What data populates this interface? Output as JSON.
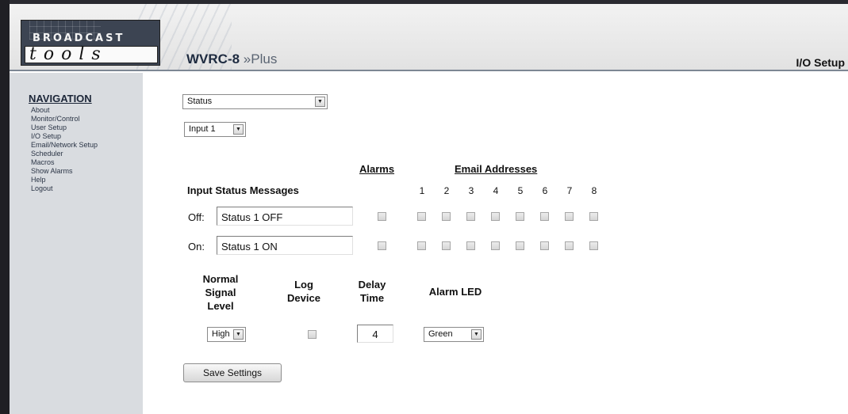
{
  "header": {
    "logo_top": "BROADCAST",
    "logo_bottom": "tools",
    "product_name": "WVRC-8",
    "product_suffix": "»Plus",
    "page_heading": "I/O Setup"
  },
  "navigation": {
    "heading": "NAVIGATION",
    "items": [
      "About",
      "Monitor/Control",
      "User Setup",
      "I/O Setup",
      "Email/Network Setup",
      "Scheduler",
      "Macros",
      "Show Alarms",
      "Help",
      "Logout"
    ]
  },
  "form": {
    "type_select": "Status",
    "input_select": "Input 1",
    "alarms_heading": "Alarms",
    "email_heading": "Email Addresses",
    "email_numbers": [
      "1",
      "2",
      "3",
      "4",
      "5",
      "6",
      "7",
      "8"
    ],
    "messages_heading": "Input Status Messages",
    "rows": [
      {
        "label": "Off:",
        "value": "Status 1 OFF",
        "alarm": false,
        "emails": [
          false,
          false,
          false,
          false,
          false,
          false,
          false,
          false
        ]
      },
      {
        "label": "On:",
        "value": "Status 1 ON",
        "alarm": false,
        "emails": [
          false,
          false,
          false,
          false,
          false,
          false,
          false,
          false
        ]
      }
    ],
    "signal_heading": [
      "Normal",
      "Signal",
      "Level"
    ],
    "log_heading": [
      "Log",
      "Device"
    ],
    "delay_heading": [
      "Delay",
      "Time"
    ],
    "led_heading": "Alarm LED",
    "signal_value": "High",
    "log_checked": false,
    "delay_value": "4",
    "led_value": "Green",
    "save_label": "Save Settings"
  },
  "colors": {
    "sidebar_bg": "#d9dce0",
    "nav_text": "#2b3546",
    "title_color": "#1e2b40"
  }
}
